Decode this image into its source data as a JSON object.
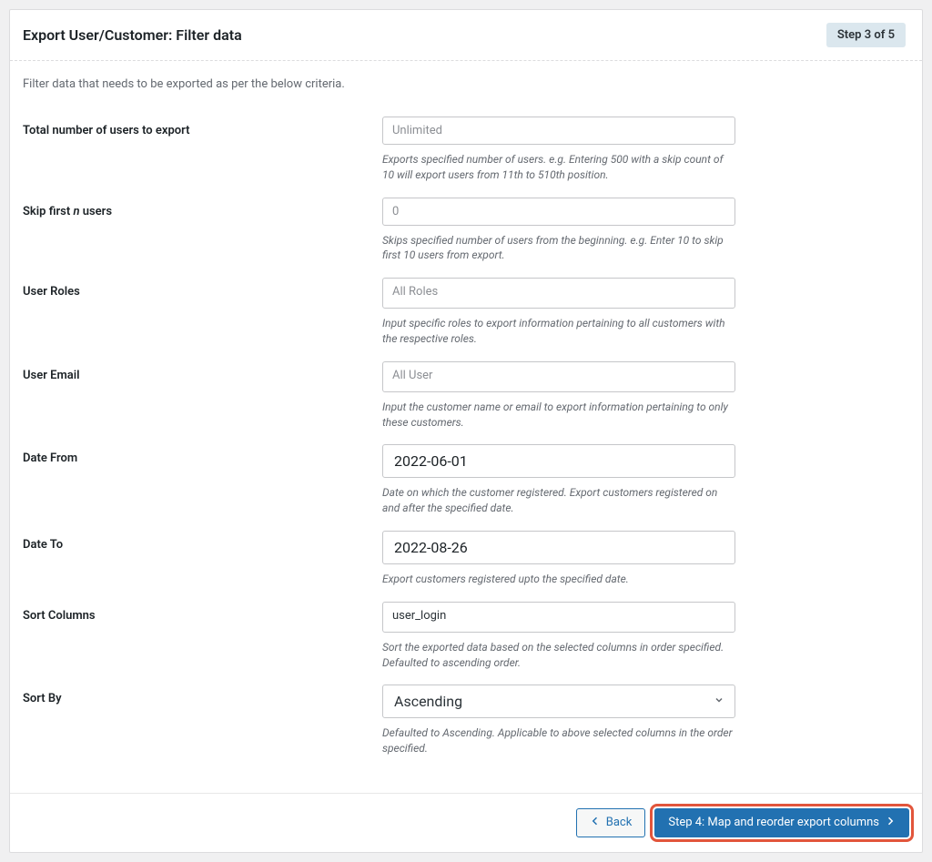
{
  "header": {
    "title": "Export User/Customer: Filter data",
    "step_label": "Step 3 of 5"
  },
  "intro": "Filter data that needs to be exported as per the below criteria.",
  "fields": {
    "total": {
      "label": "Total number of users to export",
      "placeholder": "Unlimited",
      "value": "",
      "help": "Exports specified number of users. e.g. Entering 500 with a skip count of 10 will export users from 11th to 510th position."
    },
    "skip": {
      "label_prefix": "Skip first ",
      "label_em": "n",
      "label_suffix": " users",
      "placeholder": "0",
      "value": "",
      "help": "Skips specified number of users from the beginning. e.g. Enter 10 to skip first 10 users from export."
    },
    "roles": {
      "label": "User Roles",
      "placeholder": "All Roles",
      "help": "Input specific roles to export information pertaining to all customers with the respective roles."
    },
    "email": {
      "label": "User Email",
      "placeholder": "All User",
      "help": "Input the customer name or email to export information pertaining to only these customers."
    },
    "date_from": {
      "label": "Date From",
      "value": "2022-06-01",
      "help": "Date on which the customer registered. Export customers registered on and after the specified date."
    },
    "date_to": {
      "label": "Date To",
      "value": "2022-08-26",
      "help": "Export customers registered upto the specified date."
    },
    "sort_columns": {
      "label": "Sort Columns",
      "value": "user_login",
      "help": "Sort the exported data based on the selected columns in order specified. Defaulted to ascending order."
    },
    "sort_by": {
      "label": "Sort By",
      "value": "Ascending",
      "help": "Defaulted to Ascending. Applicable to above selected columns in the order specified."
    }
  },
  "footer": {
    "back": "Back",
    "next": "Step 4: Map and reorder export columns"
  }
}
